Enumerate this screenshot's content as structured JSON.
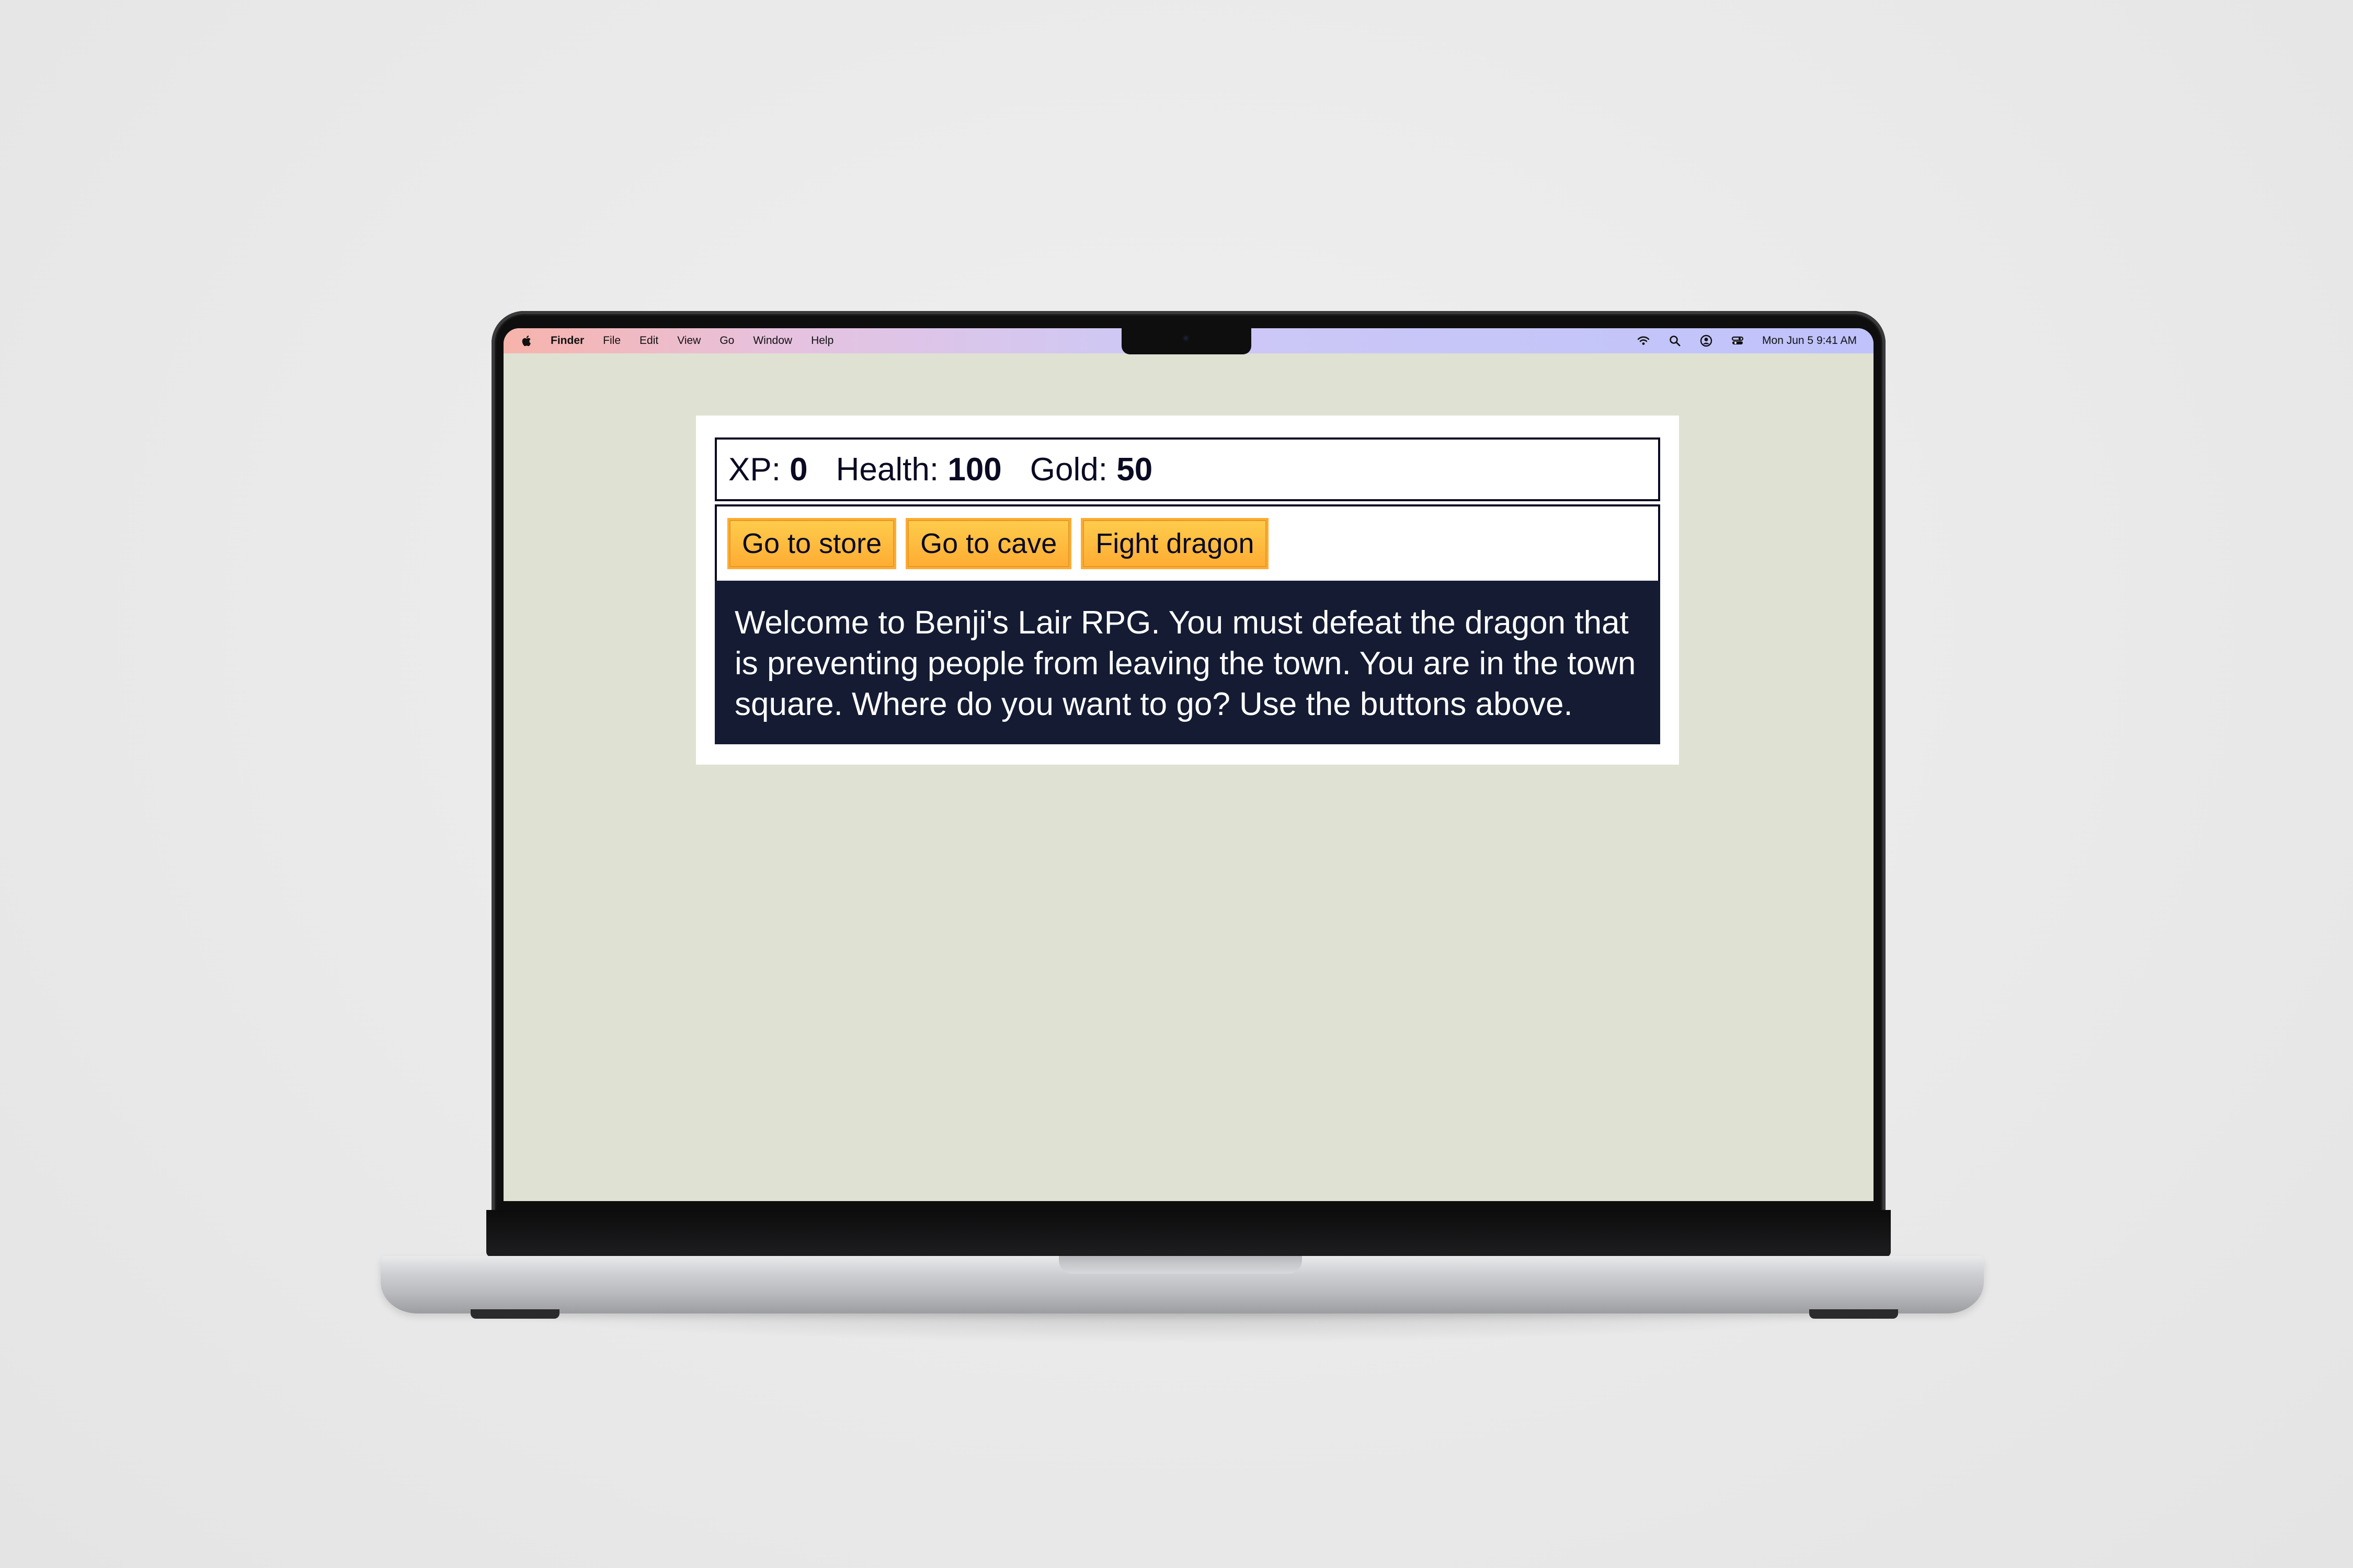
{
  "menubar": {
    "items": [
      "Finder",
      "File",
      "Edit",
      "View",
      "Go",
      "Window",
      "Help"
    ],
    "clock": "Mon Jun 5  9:41 AM"
  },
  "game": {
    "stats": [
      {
        "label": "XP:",
        "value": "0"
      },
      {
        "label": "Health:",
        "value": "100"
      },
      {
        "label": "Gold:",
        "value": "50"
      }
    ],
    "buttons": [
      "Go to store",
      "Go to cave",
      "Fight dragon"
    ],
    "text": "Welcome to Benji's Lair RPG. You must defeat the dragon that is preventing people from leaving the town. You are in the town square. Where do you want to go? Use the buttons above."
  },
  "colors": {
    "page_bg": "#dfe1d2",
    "button": "#feac32",
    "text_box": "#141b33",
    "border": "#0a0a23"
  },
  "icons": [
    "apple-icon",
    "wifi-icon",
    "search-icon",
    "user-icon",
    "control-center-icon"
  ]
}
